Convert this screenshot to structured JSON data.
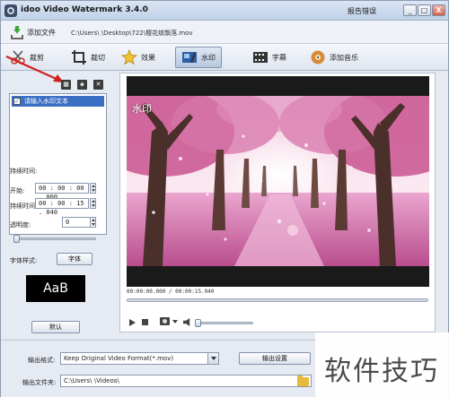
{
  "window": {
    "title": "idoo Video Watermark 3.4.0",
    "report_link": "报告错误",
    "controls": [
      "_",
      "□",
      "X"
    ]
  },
  "filebar": {
    "add_file_label": "添加文件",
    "file_path": "C:\\Users\\          \\Desktop\\722\\樱花缤飘落.mov"
  },
  "toolbar": {
    "items": [
      {
        "label": "裁剪",
        "icon": "scissors-icon"
      },
      {
        "label": "裁切",
        "icon": "crop-icon"
      },
      {
        "label": "效果",
        "icon": "effects-star-icon"
      },
      {
        "label": "水印",
        "icon": "watermark-icon"
      },
      {
        "label": "字幕",
        "icon": "subtitle-film-icon"
      },
      {
        "label": "添加音乐",
        "icon": "music-disc-icon"
      }
    ],
    "active_index": 3
  },
  "watermark_panel": {
    "text_item": "请输入水印文本",
    "duration_label": "持续时间:",
    "start_label": "开始:",
    "start_value": "00 : 00 : 00 . 000",
    "end_label": "持续时间:",
    "end_value": "00 : 00 : 15 . 040",
    "opacity_label": "透明度:",
    "opacity_value": "0",
    "opacity_level": 0,
    "font_style_label": "字体样式:",
    "font_button": "字体",
    "font_preview": "AaB",
    "default_button": "默认"
  },
  "preview": {
    "watermark_overlay": "水印",
    "time_readout": "00:00:00.000 / 00:00:15.040",
    "seek_position": 0,
    "volume_level": 0
  },
  "output": {
    "format_label": "输出格式:",
    "format_value": "Keep Original Video Format(*.mov)",
    "settings_button": "输出设置",
    "folder_label": "输出文件夹:",
    "folder_value": "C:\\Users\\          \\Videos\\"
  },
  "site_watermark": "软件技巧",
  "colors": {
    "selection": "#3b6fc4",
    "annotation_arrow": "#d02020",
    "blossom_pink": "#e58fc4"
  }
}
